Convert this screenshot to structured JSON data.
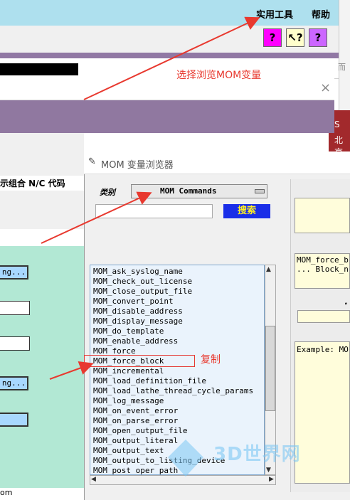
{
  "app": {
    "menu": [
      "实用工具",
      "帮助"
    ],
    "toolbar_icons": [
      "help-icon",
      "pointer-help-icon",
      "book-icon"
    ],
    "left_label": "示组合 N/C 代码",
    "left_button_text": "ng...",
    "left_bottom_text": "om",
    "right_edge_text": "而",
    "right_red_text": [
      "S",
      "北京"
    ],
    "close_label": "×"
  },
  "dialog": {
    "title": "MOM 变量浏览器",
    "category_label": "类别",
    "category_value": "MOM Commands",
    "search_button": "搜索",
    "search_value": "",
    "commands": [
      "MOM_ask_syslog_name",
      "MOM_check_out_license",
      "MOM_close_output_file",
      "MOM_convert_point",
      "MOM_disable_address",
      "MOM_display_message",
      "MOM_do_template",
      "MOM_enable_address",
      "MOM_force",
      "MOM_force_block",
      "MOM_incremental",
      "MOM_load_definition_file",
      "MOM_load_lathe_thread_cycle_params",
      "MOM_log_message",
      "MOM_on_event_error",
      "MOM_on_parse_error",
      "MOM_open_output_file",
      "MOM_output_literal",
      "MOM_output_text",
      "MOM_output_to_listing_device",
      "MOM_post_oper_path"
    ],
    "selected_command": "MOM_force_block",
    "detail_lines": [
      "MOM_force_b",
      "... Block_n"
    ],
    "example_text": "Example: MO"
  },
  "annotations": {
    "select_browse": "选择浏览MOM变量",
    "copy": "复制"
  },
  "watermark": "3D世界网",
  "colors": {
    "menubar": "#aee0ee",
    "purple": "#9078a0",
    "search_button_bg": "#1a2ee8",
    "search_button_fg": "#ffee22",
    "annotation_red": "#e8392f"
  }
}
